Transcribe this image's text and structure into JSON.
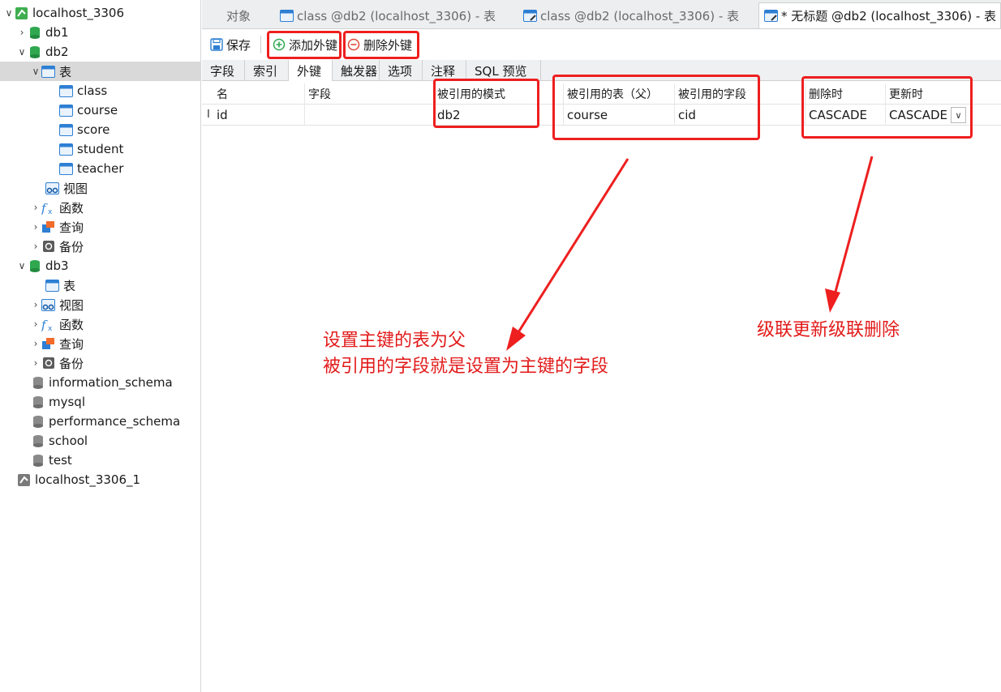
{
  "sidebar": {
    "items": [
      {
        "label": "localhost_3306",
        "icon": "connection-icon",
        "chevron": "expanded"
      },
      {
        "label": "db1",
        "icon": "database-green-icon",
        "chevron": "collapsed"
      },
      {
        "label": "db2",
        "icon": "database-green-icon",
        "chevron": "expanded"
      },
      {
        "label": "表",
        "icon": "table-folder-icon",
        "chevron": "expanded"
      },
      {
        "label": "class",
        "icon": "table-icon"
      },
      {
        "label": "course",
        "icon": "table-icon"
      },
      {
        "label": "score",
        "icon": "table-icon"
      },
      {
        "label": "student",
        "icon": "table-icon"
      },
      {
        "label": "teacher",
        "icon": "table-icon"
      },
      {
        "label": "视图",
        "icon": "view-icon"
      },
      {
        "label": "函数",
        "icon": "function-icon",
        "chevron": "collapsed"
      },
      {
        "label": "查询",
        "icon": "query-icon",
        "chevron": "collapsed"
      },
      {
        "label": "备份",
        "icon": "backup-icon",
        "chevron": "collapsed"
      },
      {
        "label": "db3",
        "icon": "database-green-icon",
        "chevron": "expanded"
      },
      {
        "label": "表",
        "icon": "table-folder-icon"
      },
      {
        "label": "视图",
        "icon": "view-icon",
        "chevron": "collapsed"
      },
      {
        "label": "函数",
        "icon": "function-icon",
        "chevron": "collapsed"
      },
      {
        "label": "查询",
        "icon": "query-icon",
        "chevron": "collapsed"
      },
      {
        "label": "备份",
        "icon": "backup-icon",
        "chevron": "collapsed"
      },
      {
        "label": "information_schema",
        "icon": "database-gray-icon"
      },
      {
        "label": "mysql",
        "icon": "database-gray-icon"
      },
      {
        "label": "performance_schema",
        "icon": "database-gray-icon"
      },
      {
        "label": "school",
        "icon": "database-gray-icon"
      },
      {
        "label": "test",
        "icon": "database-gray-icon"
      },
      {
        "label": "localhost_3306_1",
        "icon": "connection-gray-icon"
      }
    ]
  },
  "window_tabs": [
    {
      "label": "对象"
    },
    {
      "label": "class @db2 (localhost_3306) - 表"
    },
    {
      "label": "class @db2 (localhost_3306) - 表"
    },
    {
      "label": "* 无标题 @db2 (localhost_3306) - 表"
    }
  ],
  "toolbar": {
    "save_label": "保存",
    "add_fk_label": "添加外键",
    "delete_fk_label": "删除外键"
  },
  "sub_tabs": [
    {
      "label": "字段"
    },
    {
      "label": "索引"
    },
    {
      "label": "外键"
    },
    {
      "label": "触发器"
    },
    {
      "label": "选项"
    },
    {
      "label": "注释"
    },
    {
      "label": "SQL 预览"
    }
  ],
  "fk_table": {
    "headers": [
      "名",
      "字段",
      "被引用的模式",
      "被引用的表（父）",
      "被引用的字段",
      "删除时",
      "更新时"
    ],
    "rows": [
      [
        "id",
        "",
        "db2",
        "course",
        "cid",
        "CASCADE",
        "CASCADE"
      ]
    ]
  },
  "annotations": {
    "note1_line1": "设置主键的表为父",
    "note1_line2": "被引用的字段就是设置为主键的字段",
    "note2": "级联更新级联删除"
  },
  "colors": {
    "annotation_red": "#ee1f1f",
    "db_green": "#2fa84f",
    "table_blue": "#2d7fd3"
  }
}
